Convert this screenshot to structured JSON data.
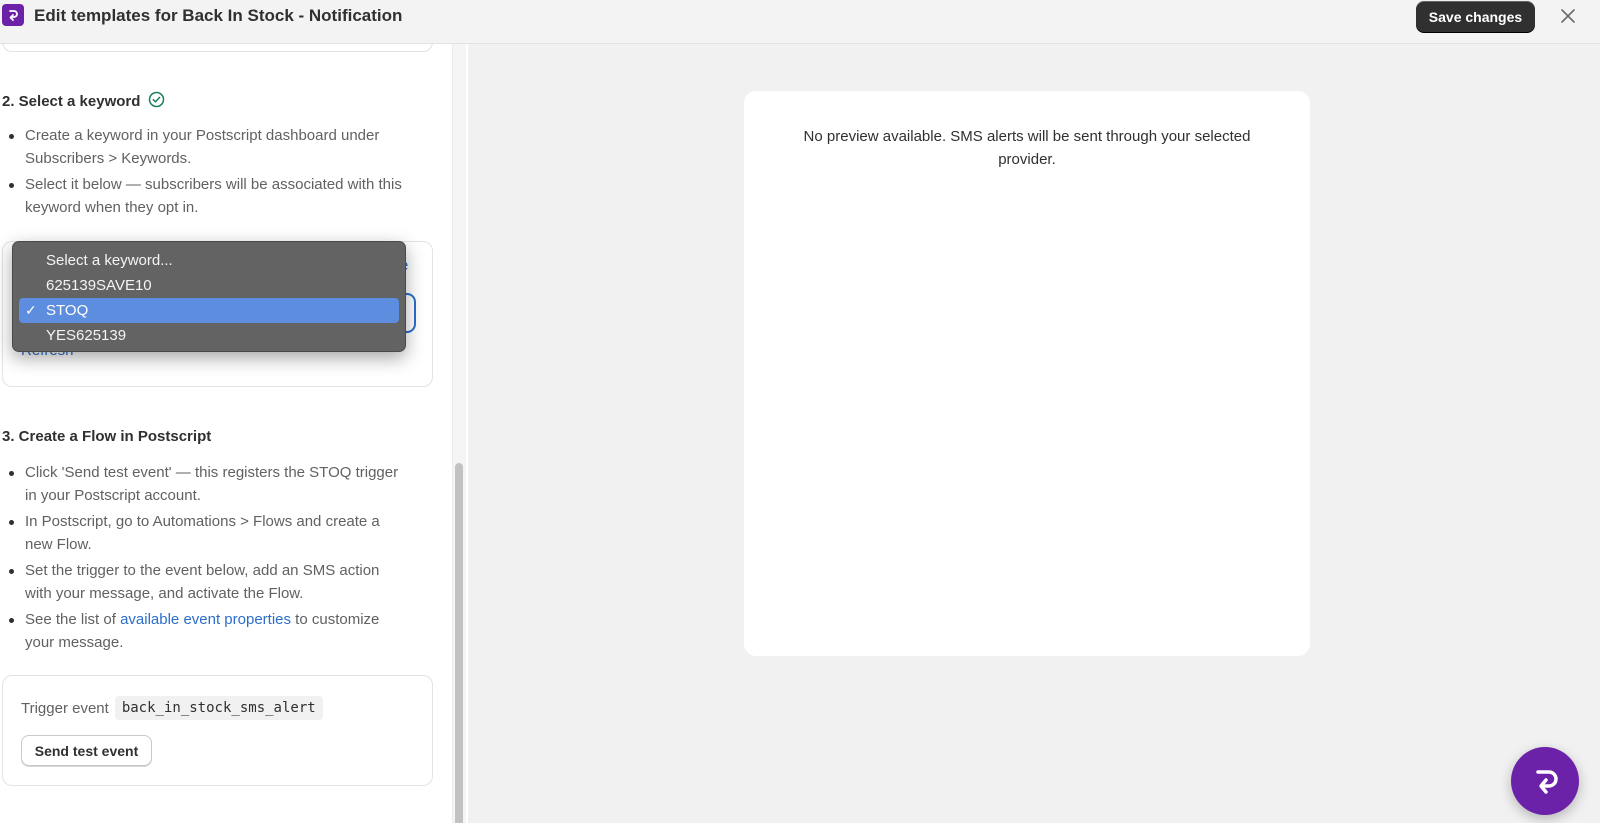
{
  "window": {
    "title": "Edit templates for Back In Stock - Notification",
    "save_label": "Save changes",
    "logo_icon": "app-logo-icon",
    "close_icon": "close-icon"
  },
  "step2": {
    "heading": "2. Select a keyword",
    "status_icon": "check-circle-icon",
    "bullets": [
      "Create a keyword in your Postscript dashboard under Subscribers > Keywords.",
      "Select it below — subscribers will be associated with this keyword when they opt in."
    ],
    "edge_link_char": "e",
    "refresh_label": "Refresh",
    "dropdown": {
      "options": [
        "Select a keyword...",
        "625139SAVE10",
        "STOQ",
        "YES625139"
      ],
      "selected": "STOQ",
      "check_mark": "✓"
    }
  },
  "step3": {
    "heading": "3. Create a Flow in Postscript",
    "bullets": [
      "Click 'Send test event' — this registers the STOQ trigger in your Postscript account.",
      "In Postscript, go to Automations > Flows and create a new Flow.",
      "Set the trigger to the event below, add an SMS action with your message, and activate the Flow."
    ],
    "last_bullet_prefix": "See the list of ",
    "last_bullet_link": "available event properties",
    "last_bullet_suffix": " to customize your message.",
    "trigger_label": "Trigger event",
    "trigger_value": "back_in_stock_sms_alert",
    "test_button": "Send test event"
  },
  "preview": {
    "message": "No preview available. SMS alerts will be sent through your selected provider."
  },
  "colors": {
    "brand": "#6b21a8",
    "link": "#2c6ecb",
    "success": "#1a7f5a",
    "selection": "#5d8ddf"
  }
}
